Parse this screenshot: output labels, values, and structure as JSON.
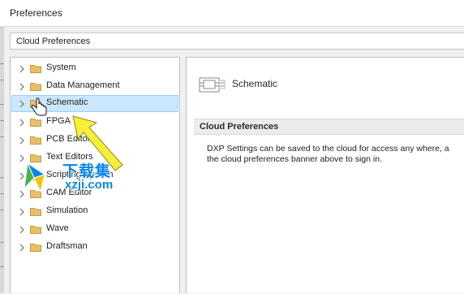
{
  "window": {
    "title": "Preferences"
  },
  "path": {
    "label": "Cloud Preferences"
  },
  "tree": {
    "items": [
      {
        "label": "System",
        "selected": false
      },
      {
        "label": "Data Management",
        "selected": false
      },
      {
        "label": "Schematic",
        "selected": true
      },
      {
        "label": "FPGA",
        "selected": false
      },
      {
        "label": "PCB Editor",
        "selected": false
      },
      {
        "label": "Text Editors",
        "selected": false
      },
      {
        "label": "Scripting System",
        "selected": false
      },
      {
        "label": "CAM Editor",
        "selected": false
      },
      {
        "label": "Simulation",
        "selected": false
      },
      {
        "label": "Wave",
        "selected": false
      },
      {
        "label": "Draftsman",
        "selected": false
      }
    ]
  },
  "main": {
    "page_title": "Schematic",
    "section_header": "Cloud Preferences",
    "description_line1": "DXP Settings can be saved to the cloud for access any where, a",
    "description_line2": "the cloud preferences banner above to sign in."
  },
  "watermark": {
    "brand": "下载集",
    "domain": "xzji.com"
  },
  "colors": {
    "selection_bg": "#cce8ff",
    "selection_border": "#99d1ff",
    "arrow_yellow": "#f5ef3a",
    "watermark_blue": "#0c86e6"
  }
}
